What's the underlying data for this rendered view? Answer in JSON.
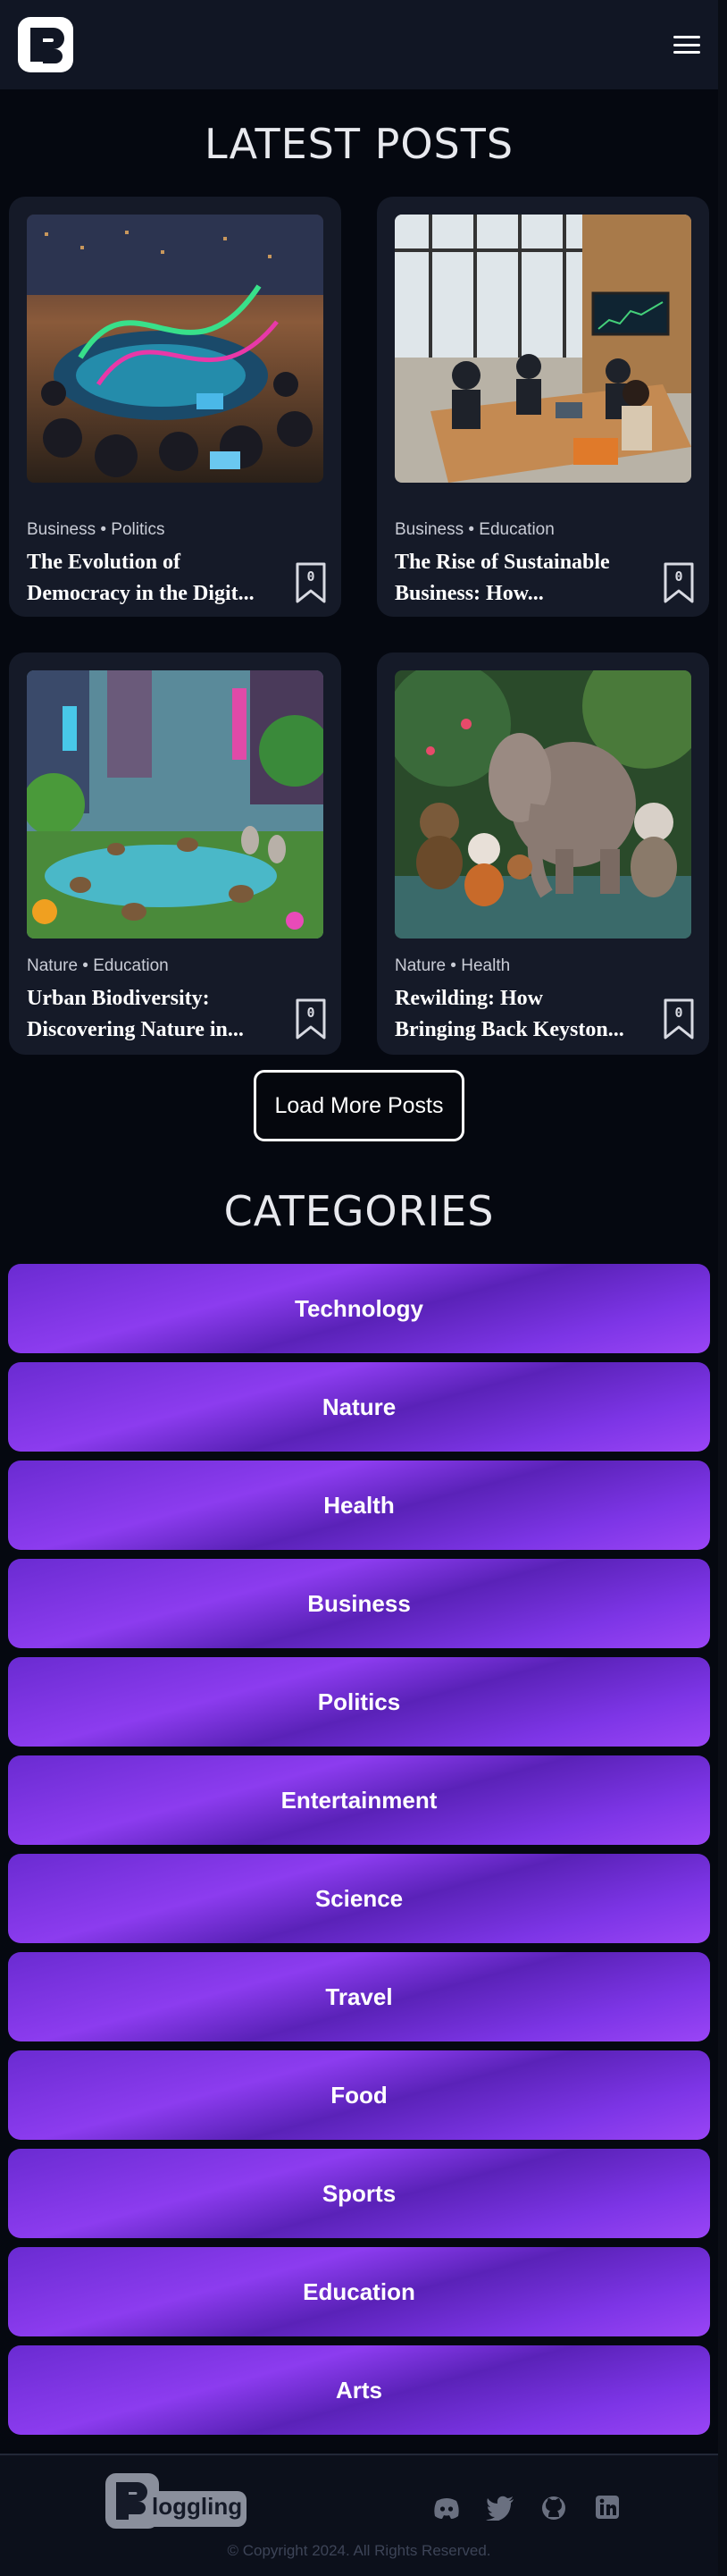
{
  "header": {
    "logo_alt": "Bloggling logo",
    "menu_icon": "hamburger-icon"
  },
  "latest": {
    "title": "LATEST POSTS",
    "posts": [
      {
        "categories": "Business • Politics",
        "title_line1": "The Evolution of",
        "title_line2": "Democracy in the Digit...",
        "bookmarks": "0",
        "image": "round-table meeting over city"
      },
      {
        "categories": "Business • Education",
        "title_line1": "The Rise of Sustainable",
        "title_line2": "Business: How...",
        "bookmarks": "0",
        "image": "office meeting room"
      },
      {
        "categories": "Nature • Education",
        "title_line1": "Urban Biodiversity:",
        "title_line2": "Discovering Nature in...",
        "bookmarks": "0",
        "image": "animals in city park"
      },
      {
        "categories": "Nature • Health",
        "title_line1": "Rewilding: How",
        "title_line2": "Bringing Back Keyston...",
        "bookmarks": "0",
        "image": "elephant and primates in jungle"
      }
    ],
    "load_more": "Load More Posts"
  },
  "categories": {
    "title": "CATEGORIES",
    "items": [
      "Technology",
      "Nature",
      "Health",
      "Business",
      "Politics",
      "Entertainment",
      "Science",
      "Travel",
      "Food",
      "Sports",
      "Education",
      "Arts"
    ]
  },
  "footer": {
    "brand": "loggling",
    "copyright": "© Copyright 2024. All Rights Reserved.",
    "social": [
      "discord-icon",
      "twitter-icon",
      "github-icon",
      "linkedin-icon"
    ]
  },
  "colors": {
    "background": "#050810",
    "card": "#151a28",
    "accent": "#8c3cef"
  }
}
